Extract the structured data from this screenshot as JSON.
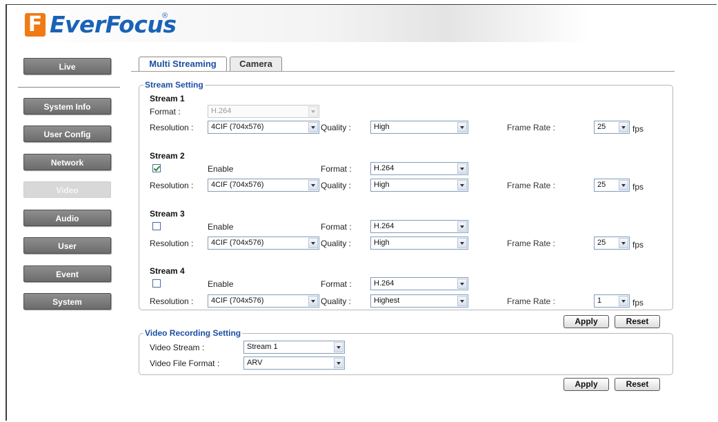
{
  "brand": {
    "name": "EverFocus",
    "reg": "®",
    "mark": "F"
  },
  "nav": [
    {
      "label": "Live"
    },
    {
      "label": "System Info"
    },
    {
      "label": "User Config"
    },
    {
      "label": "Network"
    },
    {
      "label": "Video"
    },
    {
      "label": "Audio"
    },
    {
      "label": "User"
    },
    {
      "label": "Event"
    },
    {
      "label": "System"
    }
  ],
  "tabs": [
    {
      "label": "Multi Streaming"
    },
    {
      "label": "Camera"
    }
  ],
  "stream_setting": {
    "legend": "Stream Setting",
    "labels": {
      "format": "Format :",
      "resolution": "Resolution :",
      "quality": "Quality :",
      "frame_rate": "Frame Rate :",
      "enable": "Enable",
      "fps": "fps"
    },
    "streams": [
      {
        "title": "Stream 1",
        "format": "H.264",
        "resolution": "4CIF (704x576)",
        "quality": "High",
        "frame_rate": "25"
      },
      {
        "title": "Stream 2",
        "enabled": true,
        "format": "H.264",
        "resolution": "4CIF (704x576)",
        "quality": "High",
        "frame_rate": "25"
      },
      {
        "title": "Stream 3",
        "enabled": false,
        "format": "H.264",
        "resolution": "4CIF (704x576)",
        "quality": "High",
        "frame_rate": "25"
      },
      {
        "title": "Stream 4",
        "enabled": false,
        "format": "H.264",
        "resolution": "4CIF (704x576)",
        "quality": "Highest",
        "frame_rate": "1"
      }
    ],
    "apply_label": "Apply",
    "reset_label": "Reset"
  },
  "video_recording": {
    "legend": "Video Recording Setting",
    "video_stream_label": "Video Stream :",
    "video_stream_value": "Stream 1",
    "file_format_label": "Video File Format :",
    "file_format_value": "ARV",
    "apply_label": "Apply",
    "reset_label": "Reset"
  },
  "colors": {
    "accent": "#1b4ea2",
    "logo_orange": "#f07a14",
    "logo_blue": "#1a62b7",
    "nav_button": "#7c7c7c"
  }
}
